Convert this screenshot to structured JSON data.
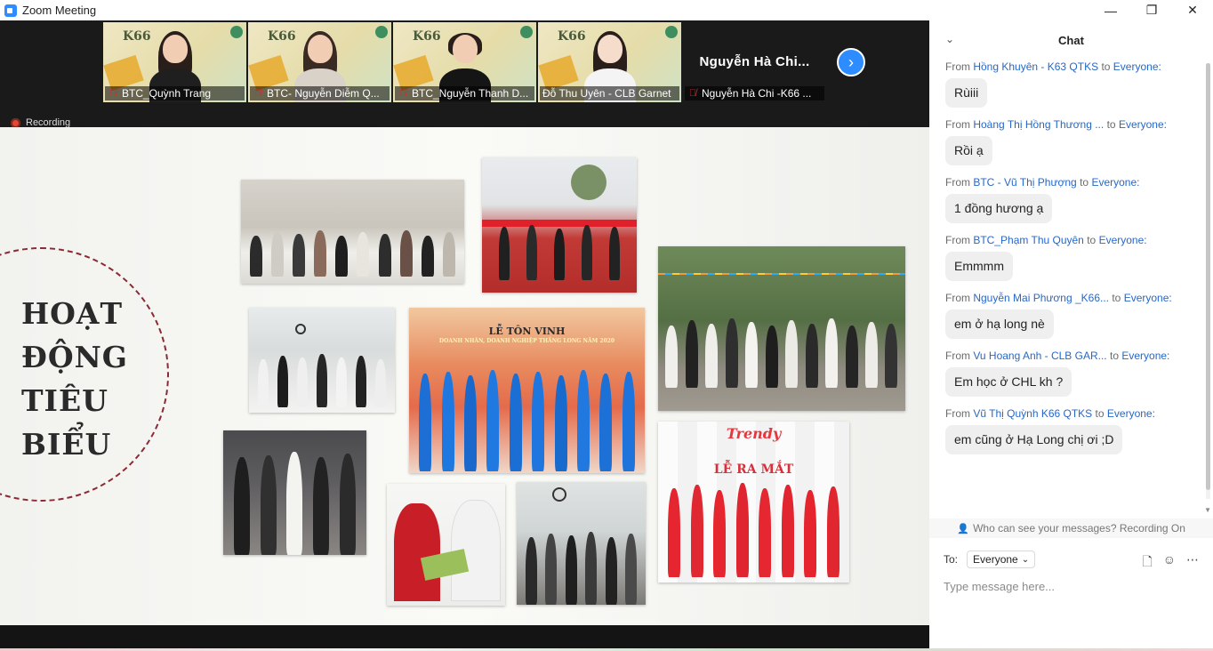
{
  "window": {
    "title": "Zoom Meeting",
    "minimize_glyph": "—",
    "restore_glyph": "❐",
    "close_glyph": "✕"
  },
  "gallery": {
    "tiles": [
      {
        "name": "BTC_Quỳnh Trang",
        "poster_text": "K66",
        "muted": true,
        "active": false
      },
      {
        "name": "BTC- Nguyễn Diễm Q...",
        "poster_text": "K66",
        "muted": true,
        "active": false
      },
      {
        "name": "BTC_Nguyễn Thanh D...",
        "poster_text": "K66",
        "muted": true,
        "active": false
      },
      {
        "name": "Đỗ Thu Uyên - CLB Garnet",
        "poster_text": "K66",
        "muted": false,
        "active": true
      },
      {
        "name": "Nguyễn Hà Chi -K66 ...",
        "big_name": "Nguyễn Hà Chi...",
        "muted": true,
        "active": false
      }
    ],
    "next_glyph": "›"
  },
  "recording": {
    "label": "Recording"
  },
  "slide": {
    "title_lines": [
      "HOẠT",
      "ĐỘNG",
      "TIÊU",
      "BIỂU"
    ],
    "banner_vinh": "LỄ TÔN VINH",
    "banner_vinh_sub": "DOANH NHÂN, DOANH NGHIỆP THĂNG LONG NĂM 2020",
    "banner_trendy": "Trendy",
    "banner_ramat": "LỄ RA MẮT"
  },
  "chat": {
    "title": "Chat",
    "from_word": "From",
    "to_word": "to",
    "messages": [
      {
        "sender": "Hồng Khuyên - K63 QTKS",
        "recipient": "Everyone:",
        "text": "Rùiii"
      },
      {
        "sender": "Hoàng Thị Hồng Thương ...",
        "recipient": "Everyone:",
        "text": "Rồi ạ"
      },
      {
        "sender": "BTC - Vũ Thị Phượng",
        "recipient": "Everyone:",
        "text": "1 đồng hương ạ"
      },
      {
        "sender": "BTC_Phạm Thu Quyên",
        "recipient": "Everyone:",
        "text": "Emmmm"
      },
      {
        "sender": "Nguyễn Mai Phương _K66...",
        "recipient": "Everyone:",
        "text": "em ở hạ long nè"
      },
      {
        "sender": "Vu Hoang Anh - CLB GAR...",
        "recipient": "Everyone:",
        "text": "Em học ở CHL kh ?"
      },
      {
        "sender": "Vũ Thị Quỳnh K66 QTKS",
        "recipient": "Everyone:",
        "text": "em cũng ở Hạ Long chị ơi ;D"
      }
    ],
    "privacy_note": "Who can see your messages? Recording On",
    "to_label": "To:",
    "to_value": "Everyone",
    "input_placeholder": "Type message here..."
  },
  "colors": {
    "zoom_blue": "#2D8CFF",
    "sender_blue": "#2668c9",
    "recording_red": "#e8472f",
    "active_speaker": "#7ad54a",
    "slide_circle": "#8a2a33"
  }
}
